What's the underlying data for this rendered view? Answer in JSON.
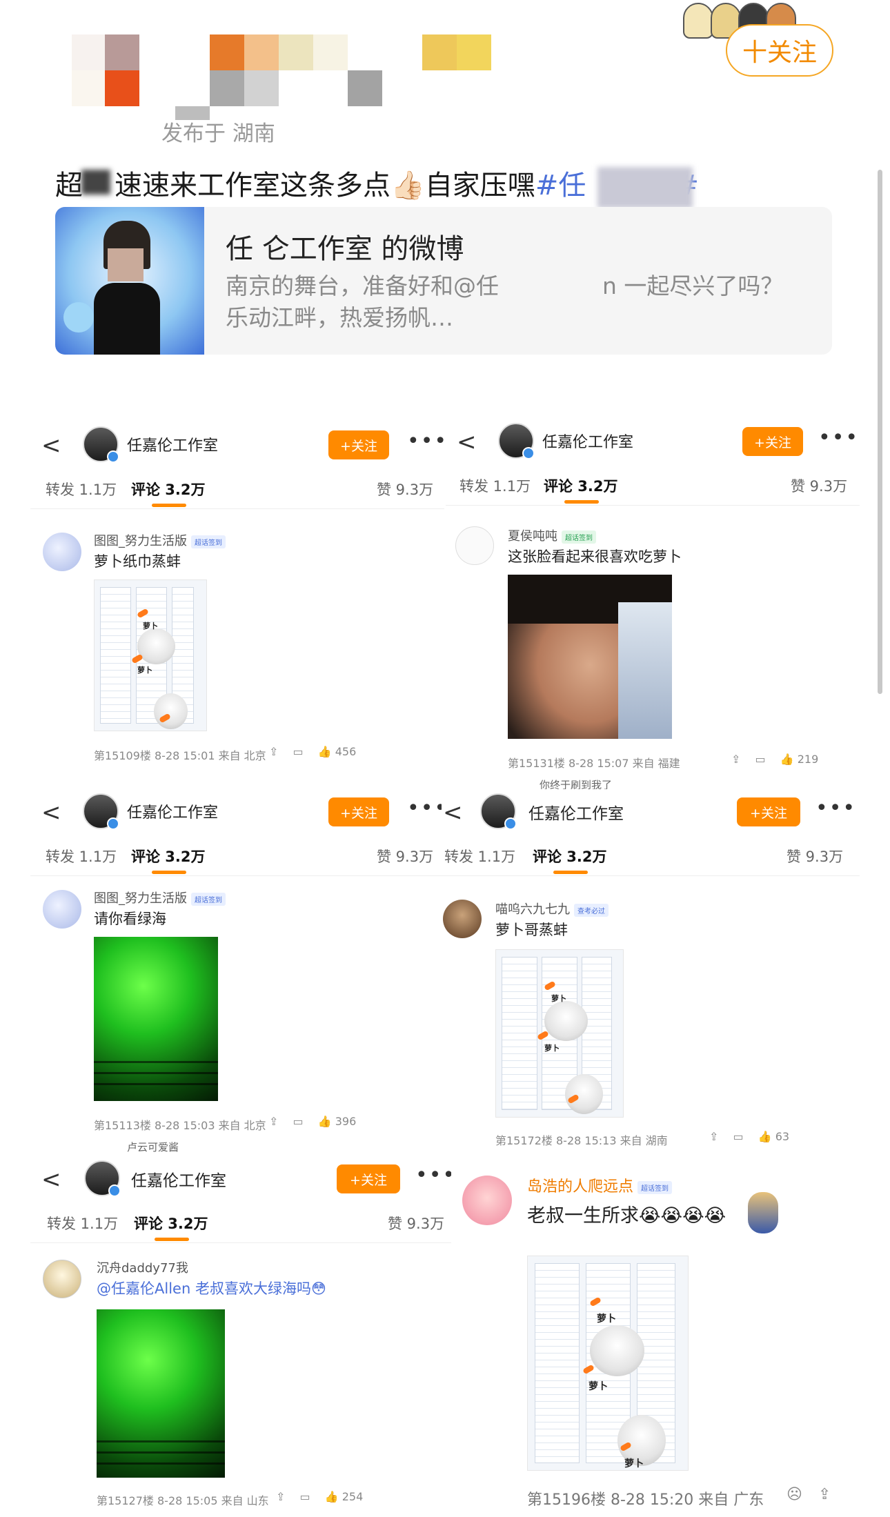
{
  "header": {
    "location": "发布于 湖南",
    "follow_label": "十关注",
    "post_text_1": "超",
    "post_text_2": "速速来工作室这条多点",
    "post_emoji": "👍🏻",
    "post_text_3": "自家压嘿",
    "post_tag_1": "#任",
    "post_tag_2": "#"
  },
  "link_card": {
    "title": "任 仑工作室 的微博",
    "desc_line1": "南京的舞台，准备好和@任",
    "desc_line1b": "n 一起尽兴了吗？",
    "desc_line2": "乐动江畔，热爱扬帆…"
  },
  "common": {
    "back": "<",
    "studio_name": "任嘉伦工作室",
    "follow": "+关注",
    "more": "•••",
    "repost": "转发 1.1万",
    "comments": "评论 3.2万",
    "likes": "赞 9.3万",
    "action_share": "⇪",
    "action_comment": "▭"
  },
  "panels": [
    {
      "user": "图图_努力生活版",
      "badge": "超话签到",
      "text": "萝卜纸巾蒸蚌",
      "meta": "第15109楼 8-28 15:01 来自 北京",
      "likes": "456",
      "next": "卢云可爱酱"
    },
    {
      "user": "夏侯吨吨",
      "badge": "超话签到",
      "text": "这张脸看起来很喜欢吃萝卜",
      "meta": "第15131楼 8-28 15:07 来自 福建",
      "likes": "219",
      "next": "你终于刷到我了"
    },
    {
      "user": "图图_努力生活版",
      "badge": "超话签到",
      "text": "请你看绿海",
      "meta": "第15113楼 8-28 15:03 来自 北京",
      "likes": "396",
      "next": "卢云可爱酱"
    },
    {
      "user": "喵呜六九七九",
      "badge": "查考必过",
      "text": "萝卜哥蒸蚌",
      "meta": "第15172楼 8-28 15:13 来自 湖南",
      "likes": "63",
      "next": ""
    },
    {
      "user": "沉舟daddy77我",
      "badge": "",
      "text": "@任嘉伦Allen 老叔喜欢大绿海吗😳",
      "meta": "第15127楼 8-28 15:05 来自 山东",
      "likes": "254",
      "next": ""
    },
    {
      "user": "岛浩的人爬远点",
      "badge": "超话签到",
      "text": "老叔一生所求😭😭😭😭",
      "meta": "第15196楼 8-28 15:20 来自 广东",
      "likes": "",
      "next": ""
    }
  ],
  "image_labels": {
    "carrot": "萝卜"
  },
  "colors": {
    "accent_orange": "#ff8a00",
    "tag_blue": "#4a6fd8",
    "green_glow": "#1fbf1f"
  }
}
